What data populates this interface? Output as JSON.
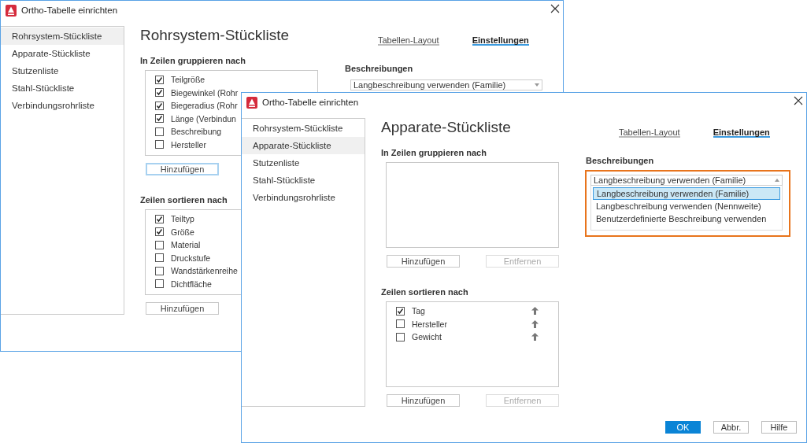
{
  "windows": [
    {
      "title": "Ortho-Tabelle einrichten",
      "sidebar": [
        {
          "label": "Rohrsystem-Stückliste",
          "selected": true
        },
        {
          "label": "Apparate-Stückliste",
          "selected": false
        },
        {
          "label": "Stutzenliste",
          "selected": false
        },
        {
          "label": "Stahl-Stückliste",
          "selected": false
        },
        {
          "label": "Verbindungsrohrliste",
          "selected": false
        }
      ],
      "heading": "Rohrsystem-Stückliste",
      "tabs": [
        {
          "label": "Tabellen-Layout",
          "selected": false
        },
        {
          "label": "Einstellungen",
          "selected": true
        }
      ],
      "group": {
        "label": "In Zeilen gruppieren nach",
        "items": [
          {
            "label": "Teilgröße",
            "checked": true
          },
          {
            "label": "Biegewinkel (Rohr",
            "checked": true
          },
          {
            "label": "Biegeradius (Rohr",
            "checked": true
          },
          {
            "label": "Länge (Verbindun",
            "checked": true
          },
          {
            "label": "Beschreibung",
            "checked": false
          },
          {
            "label": "Hersteller",
            "checked": false
          }
        ],
        "buttons": [
          {
            "label": "Hinzufügen",
            "disabled": false,
            "focused": true
          }
        ]
      },
      "sort": {
        "label": "Zeilen sortieren nach",
        "items": [
          {
            "label": "Teiltyp",
            "checked": true
          },
          {
            "label": "Größe",
            "checked": true
          },
          {
            "label": "Material",
            "checked": false
          },
          {
            "label": "Druckstufe",
            "checked": false
          },
          {
            "label": "Wandstärkenreihe",
            "checked": false
          },
          {
            "label": "Dichtfläche",
            "checked": false
          }
        ],
        "buttons": [
          {
            "label": "Hinzufügen",
            "disabled": false,
            "focused": false
          }
        ]
      },
      "descriptions": {
        "label": "Beschreibungen",
        "highlighted": false,
        "dropdown": {
          "value": "Langbeschreibung verwenden (Familie)",
          "expanded": false
        }
      }
    },
    {
      "title": "Ortho-Tabelle einrichten",
      "sidebar": [
        {
          "label": "Rohrsystem-Stückliste",
          "selected": false
        },
        {
          "label": "Apparate-Stückliste",
          "selected": true
        },
        {
          "label": "Stutzenliste",
          "selected": false
        },
        {
          "label": "Stahl-Stückliste",
          "selected": false
        },
        {
          "label": "Verbindungsrohrliste",
          "selected": false
        }
      ],
      "heading": "Apparate-Stückliste",
      "tabs": [
        {
          "label": "Tabellen-Layout",
          "selected": false
        },
        {
          "label": "Einstellungen",
          "selected": true
        }
      ],
      "group": {
        "label": "In Zeilen gruppieren nach",
        "buttons": [
          {
            "label": "Hinzufügen",
            "disabled": false,
            "focused": false
          },
          {
            "label": "Entfernen",
            "disabled": true,
            "focused": false
          }
        ]
      },
      "sort": {
        "label": "Zeilen sortieren nach",
        "items": [
          {
            "label": "Tag",
            "checked": true,
            "movable": true
          },
          {
            "label": "Hersteller",
            "checked": false,
            "movable": true
          },
          {
            "label": "Gewicht",
            "checked": false,
            "movable": true
          }
        ],
        "buttons": [
          {
            "label": "Hinzufügen",
            "disabled": false,
            "focused": false
          },
          {
            "label": "Entfernen",
            "disabled": true,
            "focused": false
          }
        ]
      },
      "descriptions": {
        "label": "Beschreibungen",
        "highlighted": true,
        "dropdown": {
          "value": "Langbeschreibung verwenden (Familie)",
          "expanded": true,
          "options": [
            {
              "label": "Langbeschreibung verwenden (Familie)",
              "selected": true
            },
            {
              "label": "Langbeschreibung verwenden (Nennweite)",
              "selected": false
            },
            {
              "label": "Benutzerdefinierte Beschreibung verwenden",
              "selected": false
            }
          ]
        }
      },
      "footer_buttons": [
        {
          "label": "OK",
          "primary": true
        },
        {
          "label": "Abbr.",
          "primary": false
        },
        {
          "label": "Hilfe",
          "primary": false
        }
      ]
    }
  ]
}
